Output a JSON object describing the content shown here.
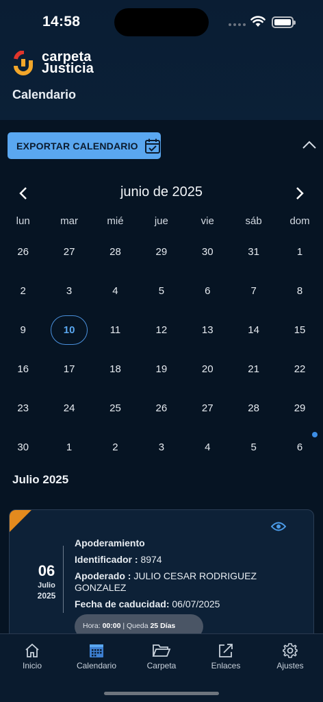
{
  "status_bar": {
    "time": "14:58"
  },
  "app": {
    "brand_line1": "carpeta",
    "brand_line2": "Justicia",
    "page_title": "Calendario"
  },
  "toolbar": {
    "export_label": "EXPORTAR CALENDARIO"
  },
  "calendar": {
    "month_title": "junio de 2025",
    "weekdays": [
      "lun",
      "mar",
      "mié",
      "jue",
      "vie",
      "sáb",
      "dom"
    ],
    "weeks": [
      [
        "26",
        "27",
        "28",
        "29",
        "30",
        "31",
        "1"
      ],
      [
        "2",
        "3",
        "4",
        "5",
        "6",
        "7",
        "8"
      ],
      [
        "9",
        "10",
        "11",
        "12",
        "13",
        "14",
        "15"
      ],
      [
        "16",
        "17",
        "18",
        "19",
        "20",
        "21",
        "22"
      ],
      [
        "23",
        "24",
        "25",
        "26",
        "27",
        "28",
        "29"
      ],
      [
        "30",
        "1",
        "2",
        "3",
        "4",
        "5",
        "6"
      ]
    ],
    "selected_day": "10",
    "accent": "#5aa7f0"
  },
  "events": {
    "section_title": "Julio 2025",
    "items": [
      {
        "day": "06",
        "month": "Julio",
        "year": "2025",
        "type": "Apoderamiento",
        "id_label": "Identificador : ",
        "id_value": "8974",
        "attorney_label": "Apoderado : ",
        "attorney_value": "JULIO CESAR RODRIGUEZ GONZALEZ",
        "expiry_label": "Fecha de caducidad: ",
        "expiry_value": "06/07/2025",
        "hour_label": "Hora: ",
        "hour_value": "00:00",
        "remaining_label": " | Queda ",
        "remaining_value": "25 Días",
        "corner_color": "#e38a1e"
      }
    ]
  },
  "tabbar": {
    "items": [
      {
        "label": "Inicio",
        "icon": "home-icon"
      },
      {
        "label": "Calendario",
        "icon": "calendar-icon"
      },
      {
        "label": "Carpeta",
        "icon": "folder-icon"
      },
      {
        "label": "Enlaces",
        "icon": "external-link-icon"
      },
      {
        "label": "Ajustes",
        "icon": "gear-icon"
      }
    ],
    "active": "Calendario"
  }
}
